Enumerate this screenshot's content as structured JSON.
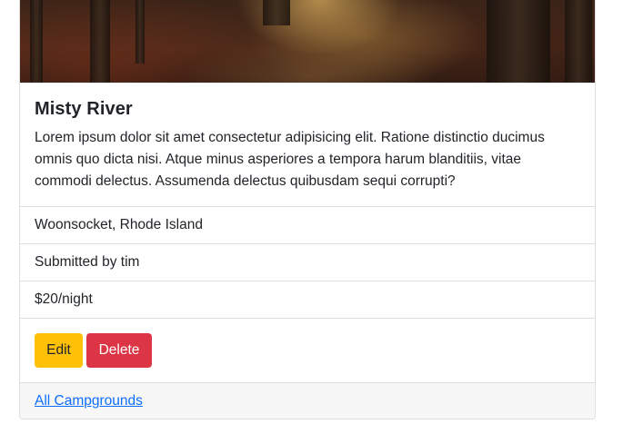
{
  "campground": {
    "title": "Misty River",
    "description": "Lorem ipsum dolor sit amet consectetur adipisicing elit. Ratione distinctio ducimus omnis quo dicta nisi. Atque minus asperiores a tempora harum blanditiis, vitae commodi delectus. Assumenda delectus quibusdam sequi corrupti?",
    "location": "Woonsocket, Rhode Island",
    "submitted_by": "Submitted by tim",
    "price": "$20/night"
  },
  "actions": {
    "edit_label": "Edit",
    "delete_label": "Delete"
  },
  "footer": {
    "link_label": "All Campgrounds"
  },
  "colors": {
    "edit_button": "#ffc107",
    "delete_button": "#dc3545",
    "link": "#0d6efd",
    "footer_bg": "#f7f7f7"
  }
}
